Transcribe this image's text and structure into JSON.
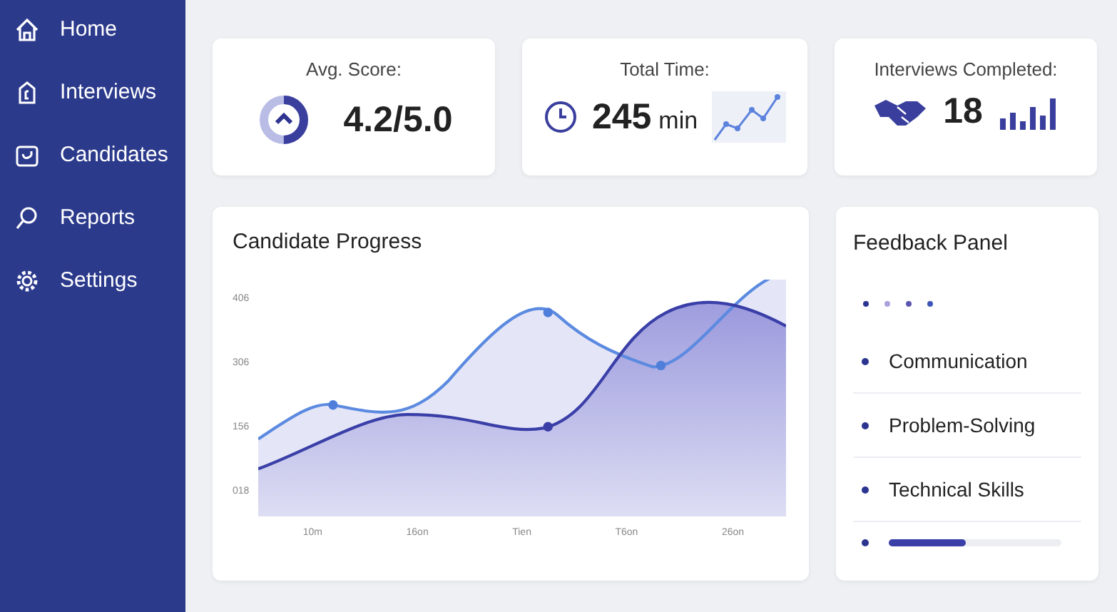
{
  "sidebar": {
    "items": [
      {
        "label": "Home",
        "kind": "home"
      },
      {
        "label": "Interviews",
        "kind": "doc"
      },
      {
        "label": "Candidates",
        "kind": "check"
      },
      {
        "label": "Reports",
        "kind": "search"
      },
      {
        "label": "Settings",
        "kind": "gear"
      }
    ]
  },
  "stats": [
    {
      "kind": "score",
      "label": "Avg. Score:",
      "value": "4.2/5.0",
      "level": 0.5
    },
    {
      "kind": "time",
      "label": "Total Time:",
      "value": "245",
      "unit": "min"
    },
    {
      "kind": "count",
      "label": "Interviews Completed:",
      "value": "18"
    }
  ],
  "progress_chart": {
    "title": "Candidate Progress",
    "y_labels": [
      "406",
      "306",
      "156",
      "018"
    ],
    "x_labels": [
      "10m",
      "16on",
      "Tien",
      "T6on",
      "26on"
    ]
  },
  "feedback": {
    "title": "Feedback Panel",
    "dots": [
      {
        "color": "#2b3590"
      },
      {
        "color": "#a9a3dc"
      },
      {
        "color": "#5a56b0"
      },
      {
        "color": "#3f55b8"
      }
    ],
    "items": [
      "Communication",
      "Problem-Solving",
      "Technical Skills"
    ],
    "level": 0.45
  }
}
